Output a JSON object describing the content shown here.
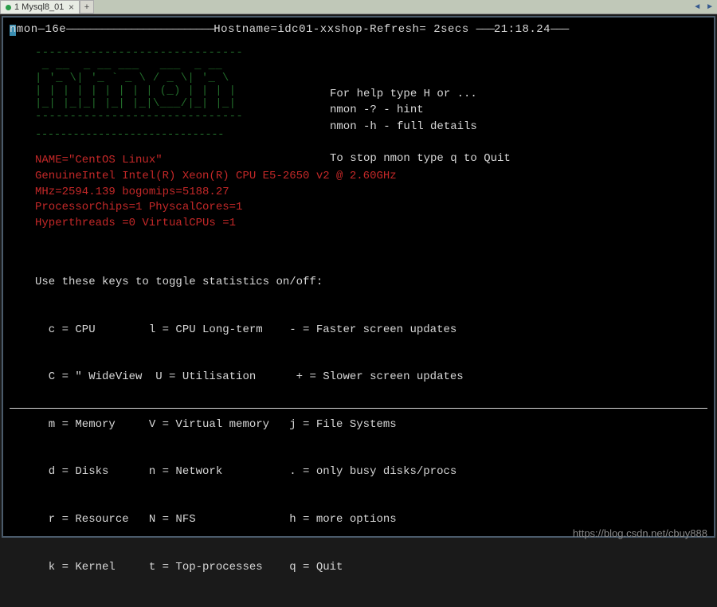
{
  "tab": {
    "label": "1 Mysql8_01",
    "close": "×",
    "add": "+",
    "nav_left": "◄",
    "nav_right": "►"
  },
  "status": {
    "prefix": "nmon—16e",
    "hostname_label": "Hostname=idc01-xxshop",
    "refresh_label": "Refresh= 2secs",
    "time": "21:18.24",
    "dash20": "—————————————————————————",
    "dash6": "———"
  },
  "ascii": "------------------------------\n _ __  _ __ ___   ___  _ __  \n| '_ \\| '_ ` _ \\ / _ \\| '_ \\ \n| | | | | | | | | (_) | | | |\n|_| |_|_| |_| |_|\\___/|_| |_|\n------------------------------",
  "help": {
    "l1": "For help type H or ...",
    "l2": " nmon -?  - hint",
    "l3": " nmon -h  - full details",
    "l4": "To stop nmon type q to Quit"
  },
  "sysinfo": {
    "l1": "NAME=\"CentOS Linux\"",
    "l2": "GenuineIntel Intel(R) Xeon(R) CPU E5-2650 v2 @ 2.60GHz",
    "l3": "MHz=2594.139 bogomips=5188.27",
    "l4": "ProcessorChips=1 PhyscalCores=1",
    "l5": "Hyperthreads  =0 VirtualCPUs =1"
  },
  "keys": {
    "title": "Use these keys to toggle statistics on/off:",
    "r1": "  c = CPU        l = CPU Long-term    - = Faster screen updates",
    "r2": "  C = \" WideView  U = Utilisation      + = Slower screen updates",
    "r3": "  m = Memory     V = Virtual memory   j = File Systems",
    "r4": "  d = Disks      n = Network          . = only busy disks/procs",
    "r5": "  r = Resource   N = NFS              h = more options",
    "r6": "  k = Kernel     t = Top-processes    q = Quit"
  },
  "watermark": "https://blog.csdn.net/cbuy888"
}
